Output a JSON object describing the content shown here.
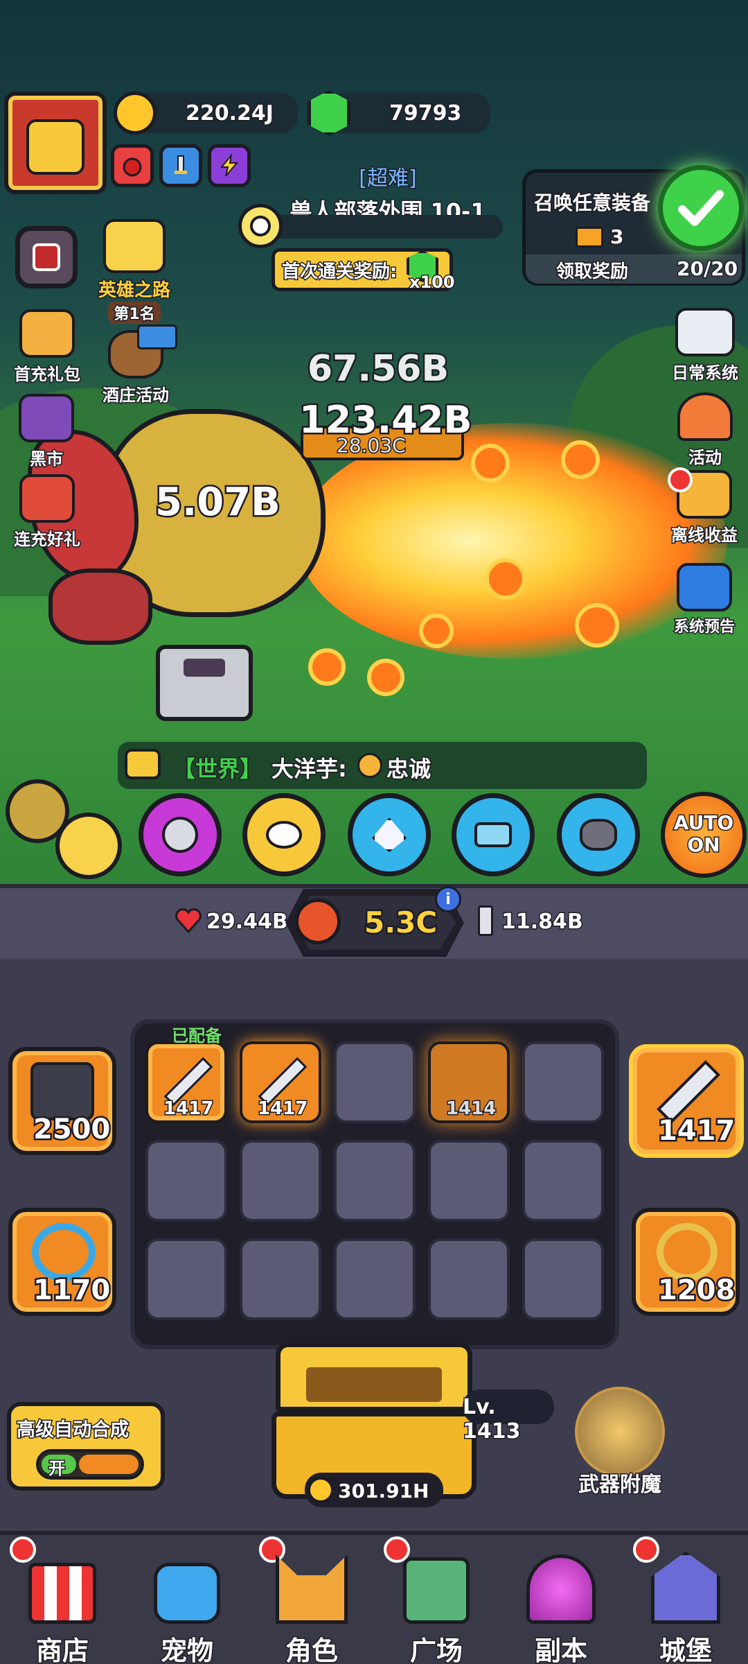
{
  "header": {
    "gold": "220.24J",
    "gems": "79793"
  },
  "stage": {
    "difficulty": "[超难]",
    "name": "兽人部落外围 10-1",
    "first_clear_label": "首次通关奖励:",
    "first_clear_count": "x100"
  },
  "quest": {
    "title": "召唤任意装备",
    "reward_count": "3",
    "claim_label": "领取奖励",
    "progress": "20/20"
  },
  "left_menu": [
    {
      "label": "英雄之路",
      "sub": "第1名"
    },
    {
      "label": "首充礼包"
    },
    {
      "label": "酒庄活动"
    },
    {
      "label": "黑市"
    },
    {
      "label": "连充好礼"
    }
  ],
  "right_menu": [
    {
      "label": "日常系统"
    },
    {
      "label": "活动"
    },
    {
      "label": "离线收益"
    },
    {
      "label": "系统预告"
    }
  ],
  "battle": {
    "dmg_top": "67.56B",
    "dmg_main": "123.42B",
    "dmg_sub": "28.03C",
    "dmg_left": "5.07B"
  },
  "chat": {
    "channel": "【世界】",
    "text": "大洋芋:",
    "text2": "忠诚"
  },
  "skills": {
    "auto_label": "AUTO",
    "auto_state": "ON"
  },
  "stats": {
    "hp": "29.44B",
    "power": "5.3C",
    "attack": "11.84B"
  },
  "equipment": {
    "left_top": "2500",
    "left_bottom": "1170",
    "right_top": "1417",
    "right_bottom": "1208"
  },
  "grid": {
    "equipped_label": "已配备",
    "slots": [
      "1417",
      "1417",
      "",
      "1414",
      "",
      "",
      "",
      "",
      "",
      "",
      "",
      "",
      "",
      "",
      ""
    ]
  },
  "chest": {
    "level": "Lv. 1413",
    "cost": "301.91H"
  },
  "auto_merge": {
    "label": "高级自动合成",
    "state": "开"
  },
  "enchant": {
    "label": "武器附魔"
  },
  "nav": [
    {
      "label": "商店"
    },
    {
      "label": "宠物"
    },
    {
      "label": "角色"
    },
    {
      "label": "广场"
    },
    {
      "label": "副本"
    },
    {
      "label": "城堡"
    }
  ],
  "colors": {
    "accent_orange": "#f08a22",
    "panel_dark": "#3e3d4f",
    "gem_green": "#3fd14a",
    "gold": "#ffd23b"
  }
}
